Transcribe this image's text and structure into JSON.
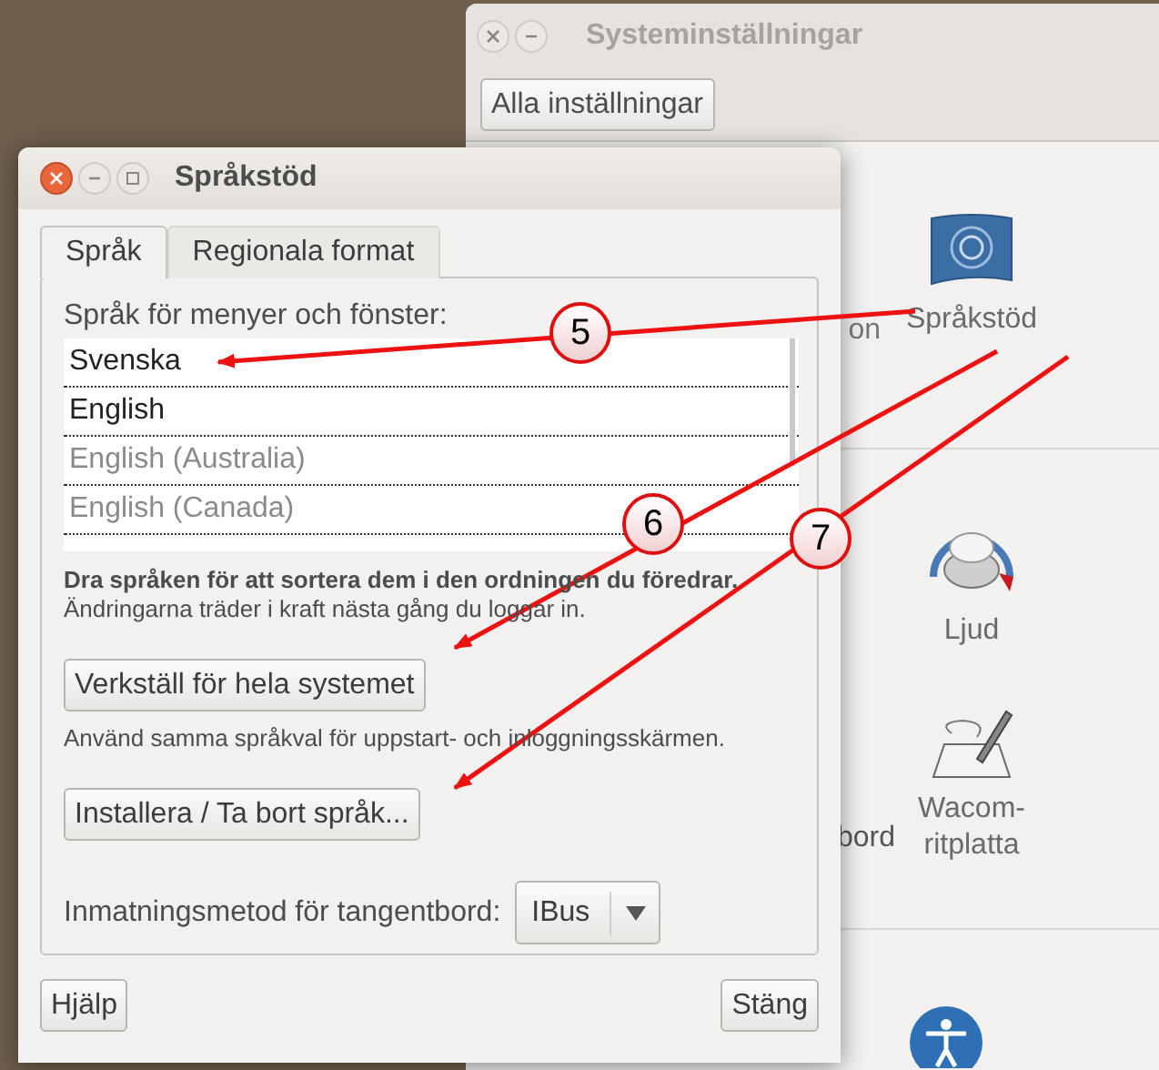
{
  "back_window": {
    "title": "Systeminställningar",
    "active": false,
    "toolbar_button": "Alla inställningar",
    "partial_labels": [
      "on",
      "bord"
    ],
    "items": [
      {
        "label": "Språkstöd",
        "kind": "flag"
      },
      {
        "label": "Ljud",
        "kind": "knob"
      },
      {
        "label": "Wacom-ritplatta",
        "kind": "tablet"
      },
      {
        "kind": "accessibility"
      }
    ]
  },
  "dialog": {
    "title": "Språkstöd",
    "active": true,
    "tabs": [
      {
        "label": "Språk",
        "selected": true
      },
      {
        "label": "Regionala format",
        "selected": false
      }
    ],
    "list_label": "Språk för menyer och fönster:",
    "languages": [
      {
        "name": "Svenska",
        "dimmed": false
      },
      {
        "name": "English",
        "dimmed": false
      },
      {
        "name": "English (Australia)",
        "dimmed": true
      },
      {
        "name": "English (Canada)",
        "dimmed": true
      }
    ],
    "drag_hint": "Dra språken för att sortera dem i den ordningen du föredrar.",
    "change_hint": "Ändringarna träder i kraft nästa gång du loggar in.",
    "apply_button": "Verkställ för hela systemet",
    "apply_hint": "Använd samma språkval för uppstart- och inloggningsskärmen.",
    "install_button": "Installera / Ta bort språk...",
    "input_method": {
      "label": "Inmatningsmetod för tangentbord:",
      "value": "IBus"
    },
    "help_button": "Hjälp",
    "close_button": "Stäng"
  },
  "callouts": [
    {
      "number": "5"
    },
    {
      "number": "6"
    },
    {
      "number": "7"
    }
  ]
}
